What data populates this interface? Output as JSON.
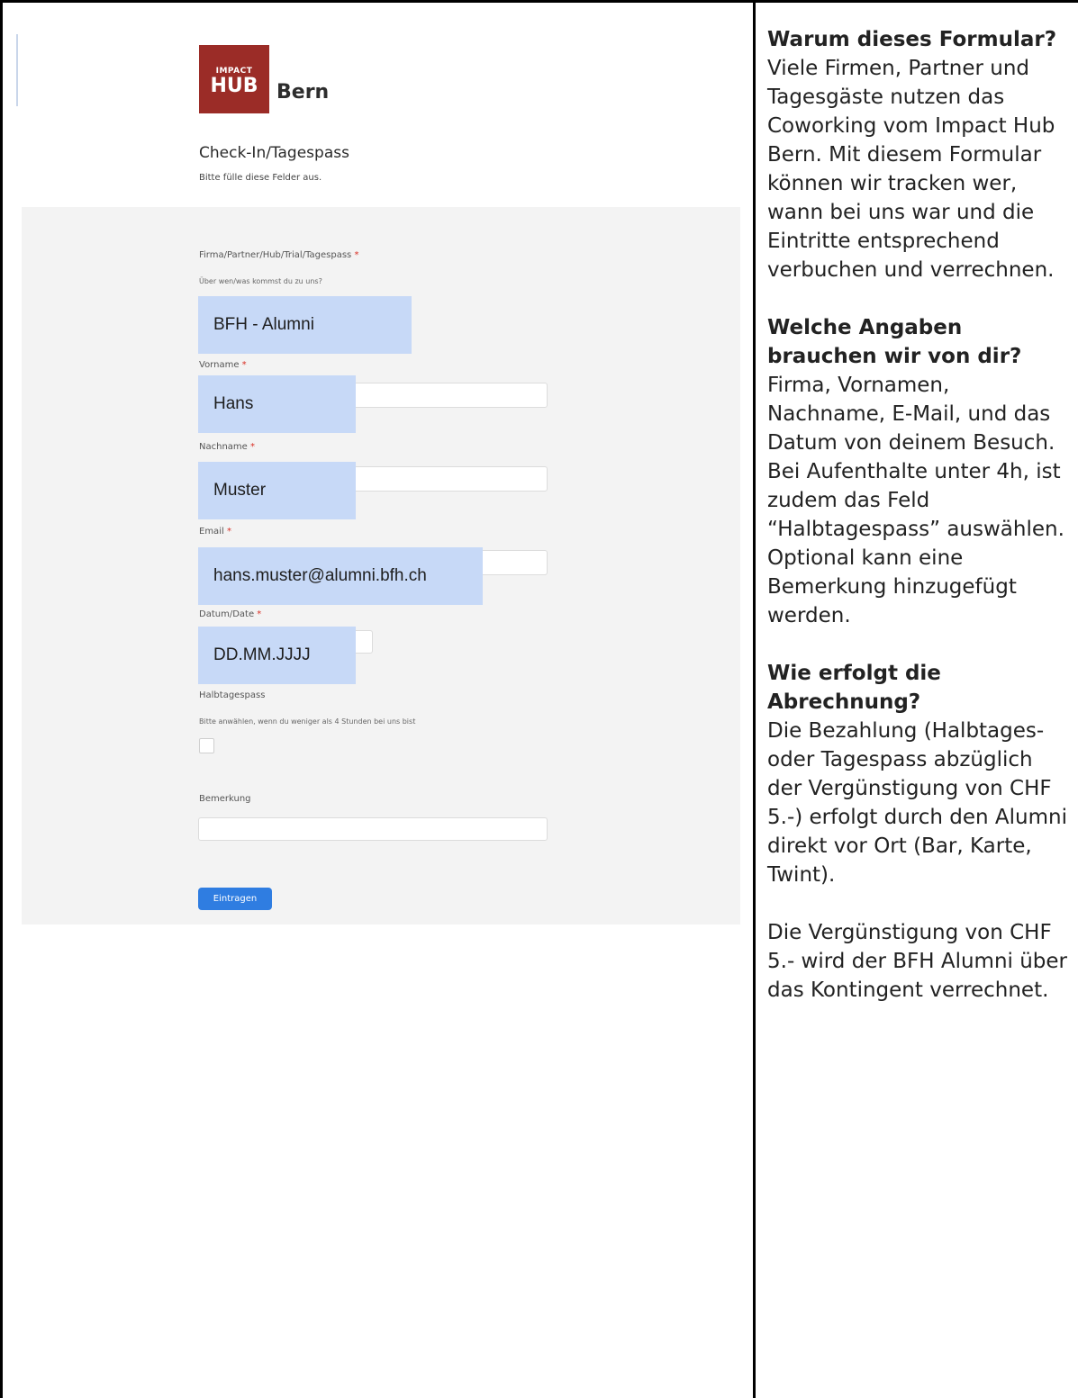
{
  "logo": {
    "small": "IMPACT",
    "big": "HUB",
    "location": "Bern"
  },
  "form": {
    "title": "Check-In/Tagespass",
    "subtitle": "Bitte fülle diese Felder aus.",
    "required_mark": "*",
    "fields": [
      {
        "label": "Firma/Partner/Hub/Trial/Tagespass",
        "hint": "Über wen/was kommst du zu uns?",
        "value": "BFH - Alumni"
      },
      {
        "label": "Vorname",
        "value": "Hans"
      },
      {
        "label": "Nachname",
        "value": "Muster"
      },
      {
        "label": "Email",
        "value": "hans.muster@alumni.bfh.ch"
      },
      {
        "label": "Datum/Date",
        "value": "DD.MM.JJJJ"
      }
    ],
    "halbtag": {
      "label": "Halbtagespass",
      "hint": "Bitte anwählen, wenn du weniger als 4 Stunden bei uns bist",
      "checked": false
    },
    "bemerkung": {
      "label": "Bemerkung",
      "value": ""
    },
    "submit_label": "Eintragen",
    "highlight_color": "#c7d9f7",
    "button_color": "#2f7de1",
    "logo_color": "#9b2c27"
  },
  "info": {
    "sections": [
      {
        "heading": "Warum dieses Formular?",
        "paragraphs": [
          "Viele Firmen, Partner und Tagesgäste nutzen das Coworking vom Impact Hub Bern. Mit diesem Formular können wir tracken wer, wann bei uns war und die Eintritte entsprechend verbuchen und verrechnen."
        ]
      },
      {
        "heading": "Welche Angaben brauchen wir von dir?",
        "paragraphs": [
          "Firma, Vornamen, Nachname, E-Mail, und das Datum von deinem Besuch. Bei Aufenthalte unter 4h, ist zudem das Feld “Halbtagespass” auswählen. Optional kann eine Bemerkung hinzugefügt werden."
        ]
      },
      {
        "heading": "Wie erfolgt die Abrechnung?",
        "paragraphs": [
          "Die Bezahlung (Halbtages- oder Tagespass abzüglich der Vergünstigung von CHF 5.-) erfolgt durch den Alumni direkt vor Ort (Bar, Karte, Twint).",
          "Die Vergünstigung von CHF 5.- wird der BFH Alumni über das Kontingent verrechnet."
        ]
      }
    ]
  }
}
